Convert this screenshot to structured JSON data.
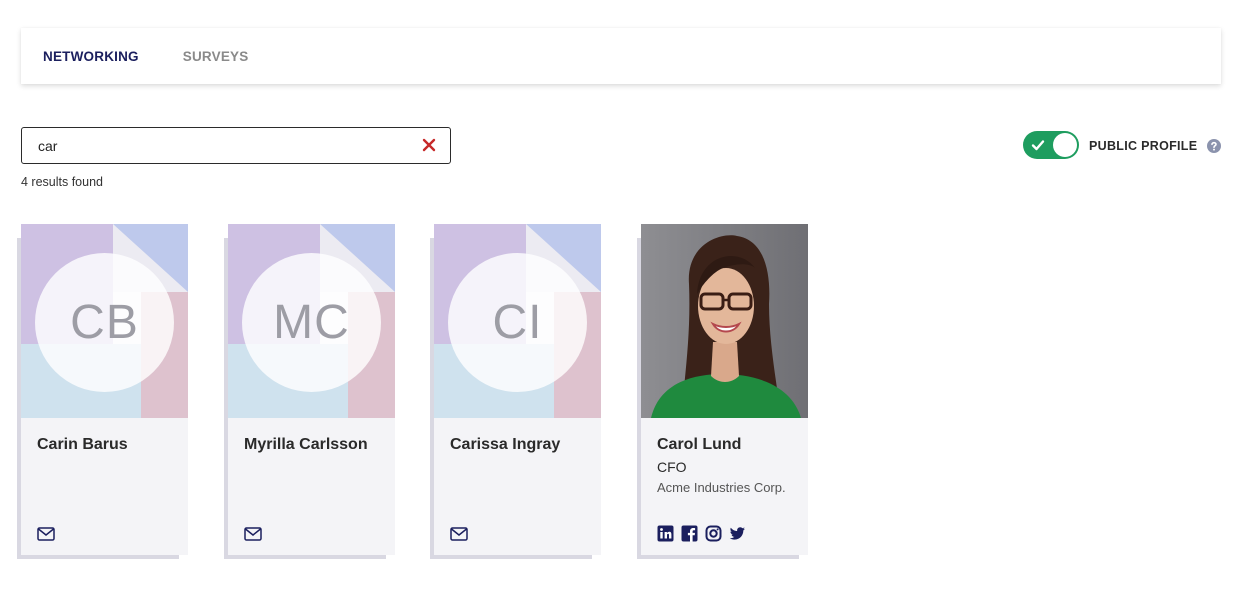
{
  "tabs": [
    {
      "label": "NETWORKING",
      "active": true
    },
    {
      "label": "SURVEYS",
      "active": false
    }
  ],
  "search": {
    "value": "car",
    "clear_icon": "close-icon"
  },
  "results_text": "4 results found",
  "public_profile": {
    "label": "PUBLIC PROFILE",
    "enabled": true,
    "help_icon": "question-circle-icon"
  },
  "colors": {
    "accent": "#1b1f5e",
    "toggle_on": "#1e9d5f",
    "clear": "#c62828"
  },
  "cards": [
    {
      "initials": "CB",
      "name": "Carin Barus",
      "contact_icon": "envelope-icon"
    },
    {
      "initials": "MC",
      "name": "Myrilla Carlsson",
      "contact_icon": "envelope-icon"
    },
    {
      "initials": "CI",
      "name": "Carissa Ingray",
      "contact_icon": "envelope-icon"
    },
    {
      "name": "Carol Lund",
      "title": "CFO",
      "company": "Acme Industries Corp.",
      "photo": "profile-photo",
      "social_icons": [
        "linkedin-icon",
        "facebook-icon",
        "instagram-icon",
        "twitter-icon"
      ]
    }
  ]
}
